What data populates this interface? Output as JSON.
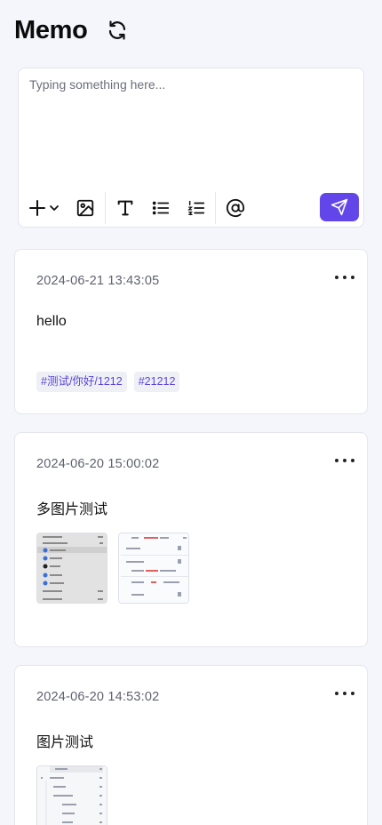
{
  "app": {
    "title": "Memo",
    "refresh_icon": "refresh-icon"
  },
  "editor": {
    "placeholder": "Typing something here...",
    "value": "",
    "toolbar": [
      {
        "name": "add-icon",
        "label": "+"
      },
      {
        "name": "image-icon"
      },
      {
        "name": "text-icon"
      },
      {
        "name": "bullet-list-icon"
      },
      {
        "name": "ordered-list-icon"
      },
      {
        "name": "mention-icon"
      }
    ],
    "send_icon": "send-icon",
    "accent": "#6246ea"
  },
  "memos": [
    {
      "date": "2024-06-21 13:43:05",
      "content": "hello",
      "tags": [
        "#测试/你好/1212",
        "#21212"
      ]
    },
    {
      "date": "2024-06-20 15:00:02",
      "content": "多图片测试",
      "images": 2
    },
    {
      "date": "2024-06-20 14:53:02",
      "content": "图片测试",
      "images": 1
    }
  ],
  "colors": {
    "background": "#f4f6fb",
    "tag_text": "#5c44d8",
    "tag_bg": "#eef0f5"
  }
}
